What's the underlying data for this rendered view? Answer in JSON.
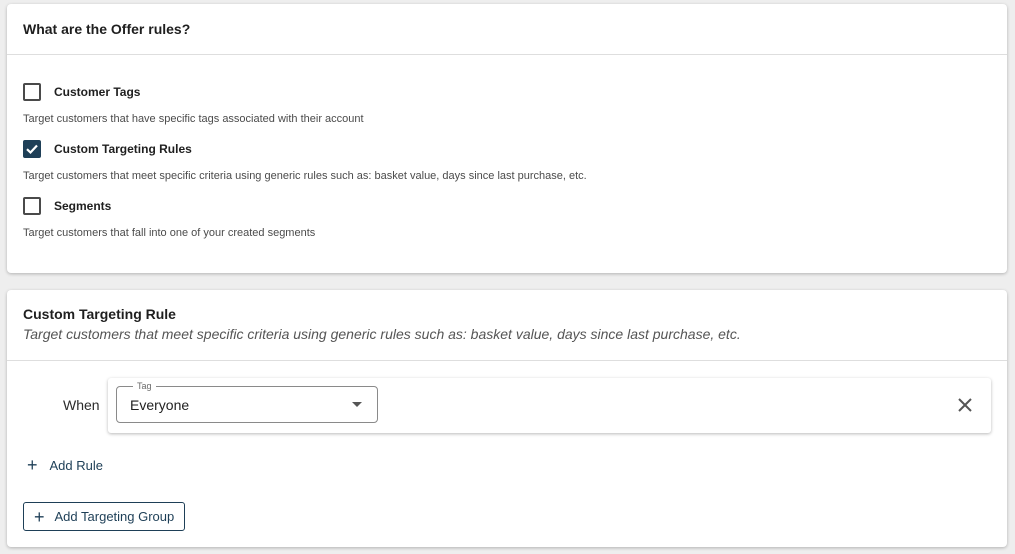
{
  "offer_rules": {
    "title": "What are the Offer rules?",
    "options": [
      {
        "label": "Customer Tags",
        "description": "Target customers that have specific tags associated with their account",
        "checked": false
      },
      {
        "label": "Custom Targeting Rules",
        "description": "Target customers that meet specific criteria using generic rules such as: basket value, days since last purchase, etc.",
        "checked": true
      },
      {
        "label": "Segments",
        "description": "Target customers that fall into one of your created segments",
        "checked": false
      }
    ]
  },
  "custom_rule": {
    "title": "Custom Targeting Rule",
    "subtitle": "Target customers that meet specific criteria using generic rules such as: basket value, days since last purchase, etc.",
    "when_label": "When",
    "tag_select": {
      "legend": "Tag",
      "value": "Everyone"
    },
    "add_rule_label": "Add Rule",
    "add_group_label": "Add Targeting Group"
  },
  "icons": {
    "check": "check-icon",
    "close": "close-icon",
    "caret": "caret-down-icon",
    "plus": "plus-icon"
  },
  "colors": {
    "accent": "#1e3f57",
    "checkbox_border": "#4a4a4a"
  }
}
